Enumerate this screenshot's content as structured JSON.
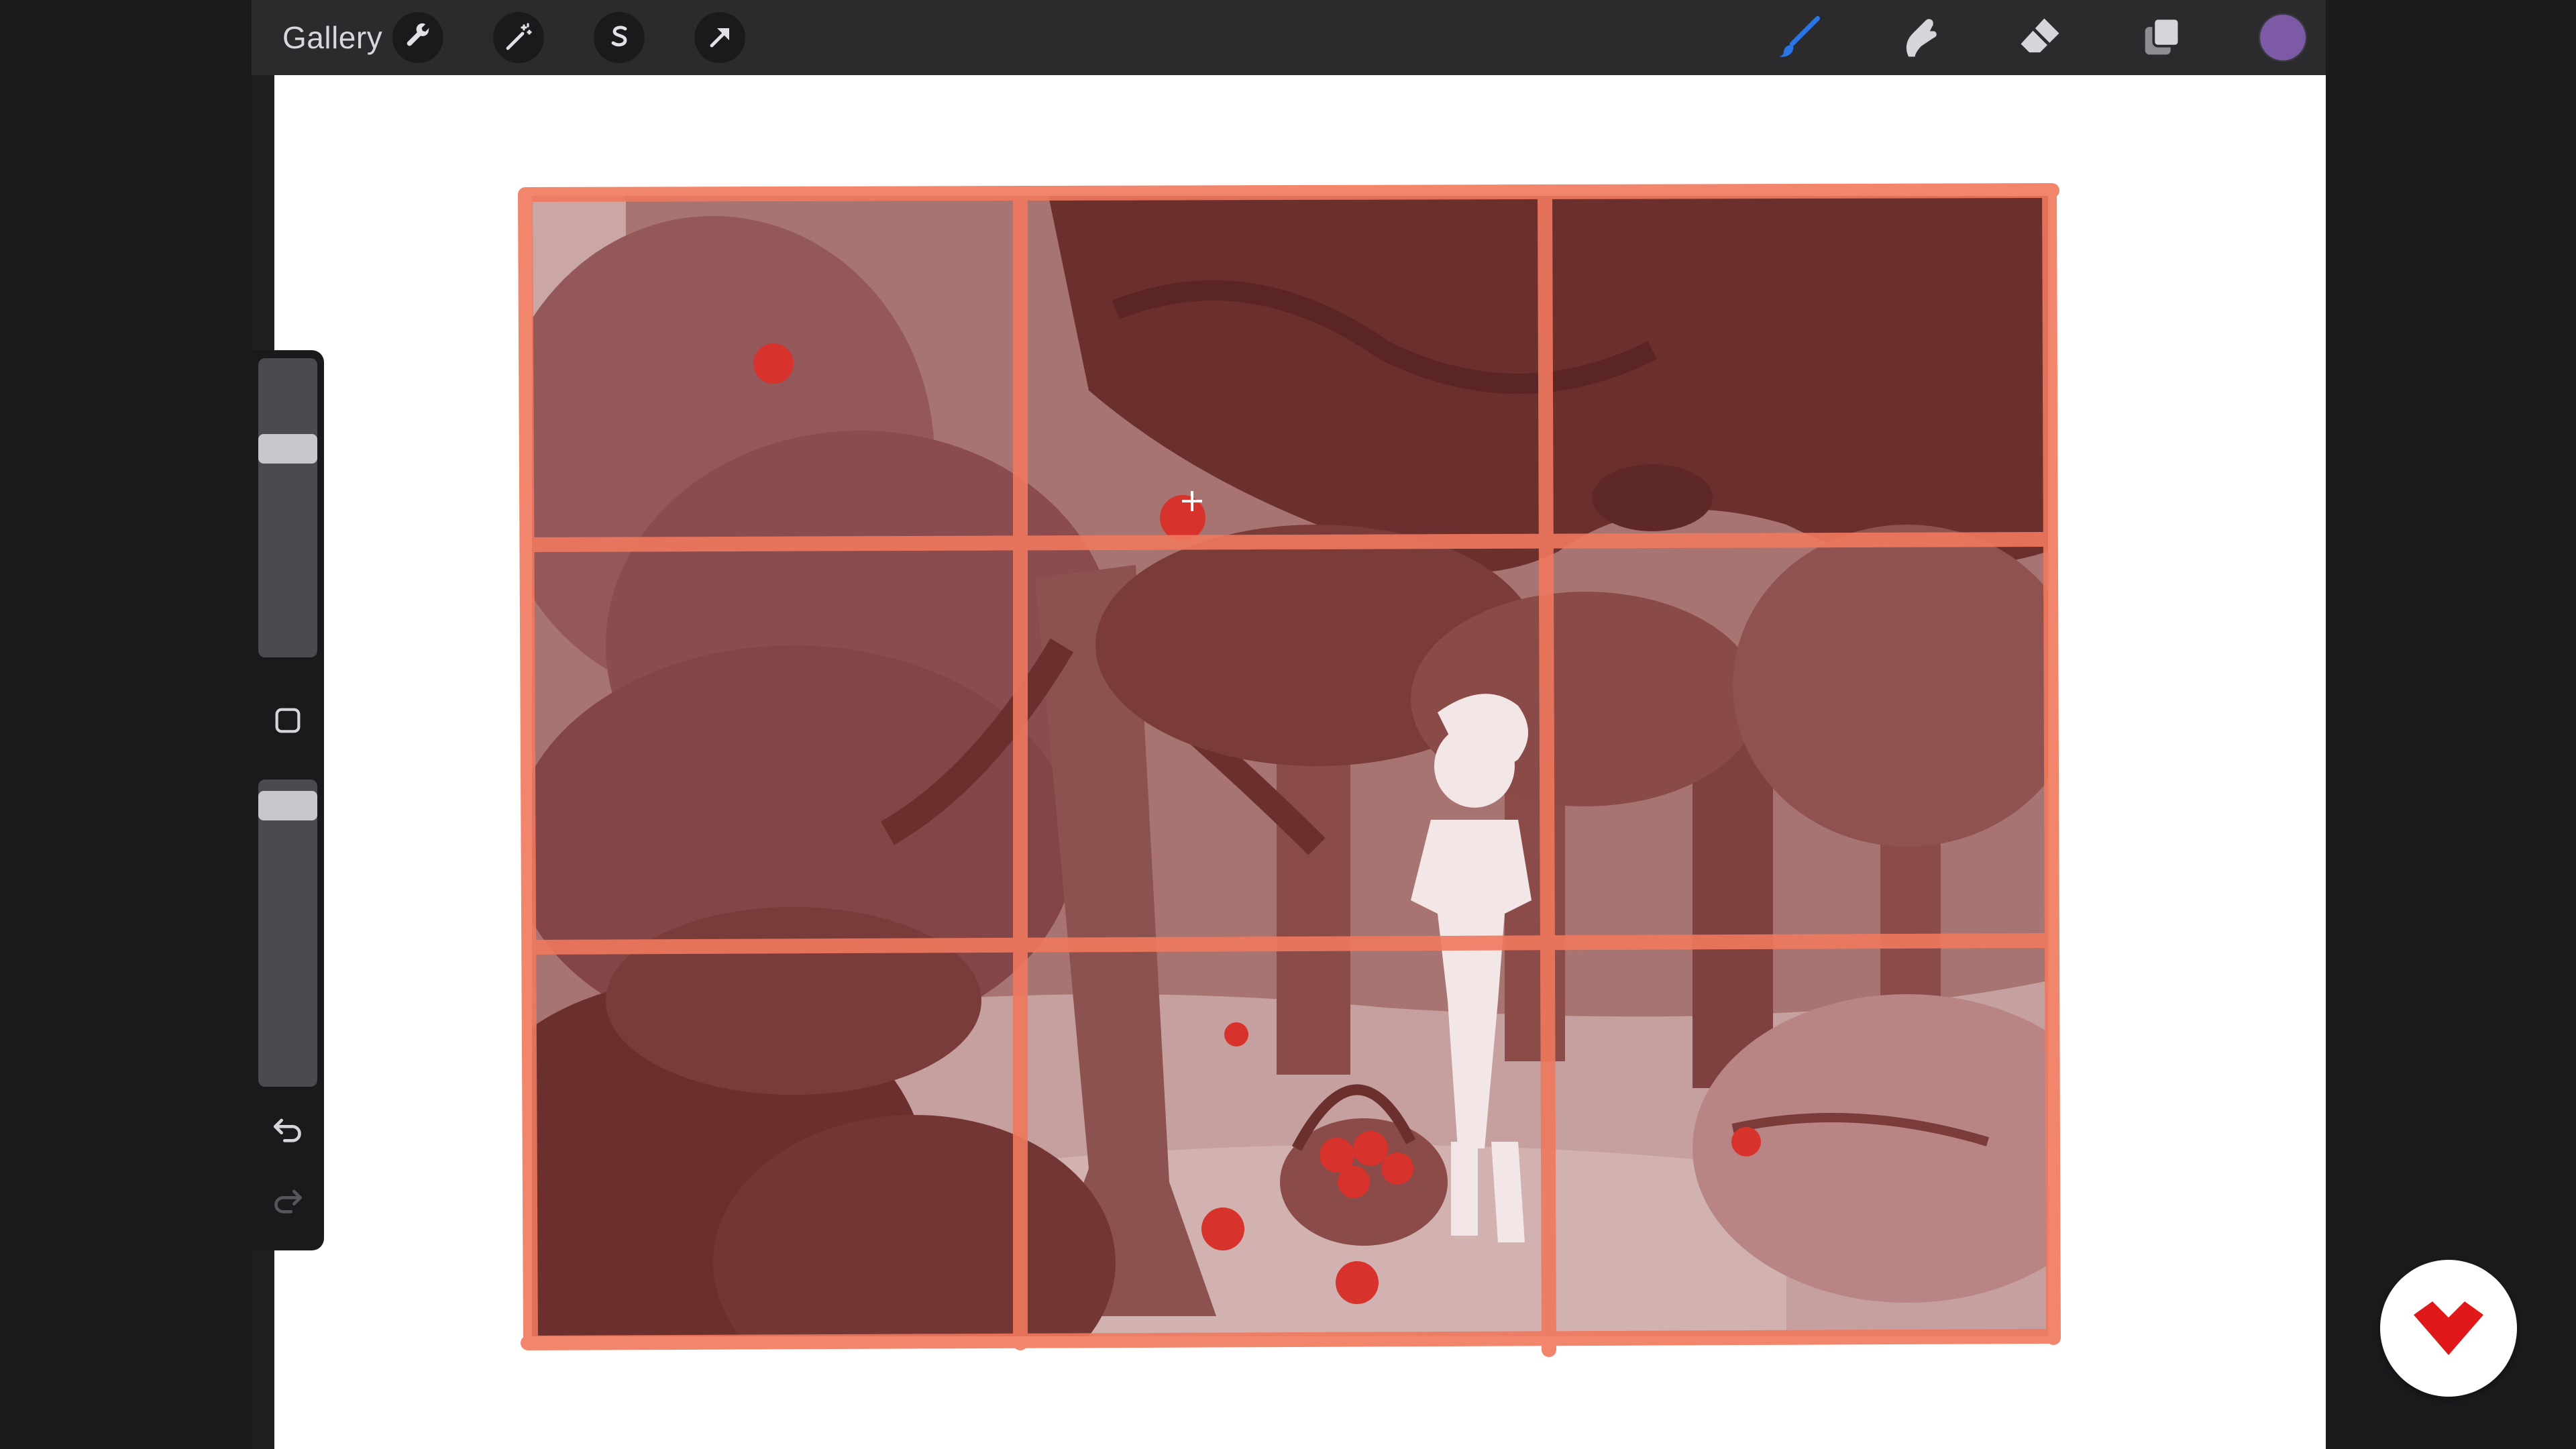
{
  "topbar": {
    "gallery_label": "Gallery",
    "left_tools": [
      {
        "name": "actions",
        "icon": "wrench-icon"
      },
      {
        "name": "adjustments",
        "icon": "magic-wand-icon"
      },
      {
        "name": "selection",
        "icon": "selection-s-icon"
      },
      {
        "name": "transform",
        "icon": "cursor-arrow-icon"
      }
    ],
    "right_tools": [
      {
        "name": "brush",
        "icon": "brush-icon",
        "active": true
      },
      {
        "name": "smudge",
        "icon": "smudge-finger-icon",
        "active": false
      },
      {
        "name": "eraser",
        "icon": "eraser-icon",
        "active": false
      },
      {
        "name": "layers",
        "icon": "layers-icon",
        "active": false
      }
    ],
    "current_color": "#7c5aa6"
  },
  "sidebar": {
    "brush_size_level": 0.28,
    "opacity_level": 0.96,
    "modify_icon": "square-icon",
    "undo_icon": "undo-icon",
    "redo_icon": "redo-icon"
  },
  "artwork": {
    "description_icon": "painting-image",
    "palette": {
      "dark": "#6b2f2d",
      "mid": "#8a4745",
      "light": "#b98a88",
      "grid_line": "#f0795e",
      "apple": "#d8322c",
      "figure": "#f3e6e6"
    }
  },
  "badge": {
    "icon": "domestika-logo-icon",
    "color": "#e0181a"
  }
}
